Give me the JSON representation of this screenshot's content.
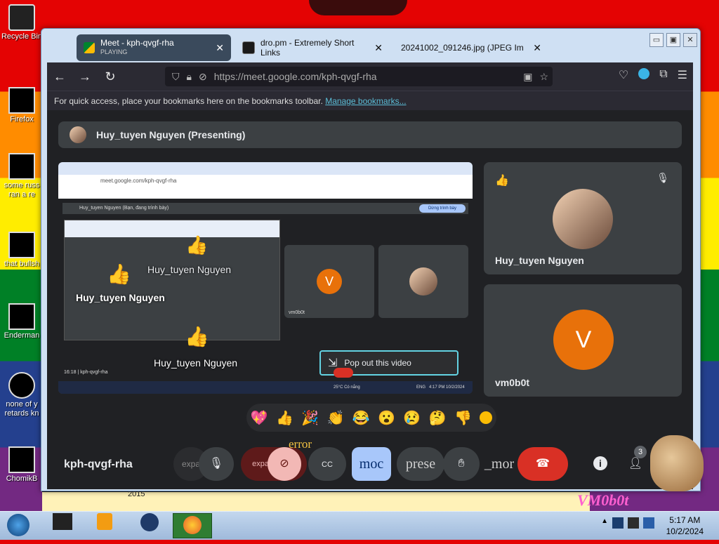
{
  "desktop": {
    "icons": [
      {
        "label": "Recycle Bin",
        "icon": "recycle-bin-icon"
      },
      {
        "label": "Firefox",
        "icon": "firefox-icon"
      },
      {
        "label": "some russ ran a re",
        "icon": "shortcut-icon"
      },
      {
        "label": "that bullsh",
        "icon": "shortcut-icon"
      },
      {
        "label": "Enderman",
        "icon": "shortcut-icon"
      },
      {
        "label": "none of y retards kn",
        "icon": "shortcut-icon"
      },
      {
        "label": "ChomikB",
        "icon": "shortcut-icon"
      }
    ],
    "sticker_text": "VM0b0t",
    "year_text": "2015"
  },
  "browser": {
    "tabs": [
      {
        "title": "Meet - kph-qvgf-rha",
        "subtitle": "PLAYING",
        "icon": "google-meet-icon",
        "close": "✕"
      },
      {
        "title": "dro.pm - Extremely Short Links",
        "icon": "dropm-icon",
        "close": "✕"
      },
      {
        "title": "20241002_091246.jpg (JPEG Image, 4",
        "icon": "image-icon",
        "close": "✕"
      }
    ],
    "window_buttons": [
      "▭",
      "▣",
      "✕"
    ],
    "url": "https://meet.google.com/kph-qvgf-rha",
    "bookmarks_text": "For quick access, place your bookmarks here on the bookmarks toolbar.",
    "bookmarks_link": "Manage bookmarks..."
  },
  "meet": {
    "presenting_label": "Huy_tuyen Nguyen (Presenting)",
    "shared_screen": {
      "inner_url": "meet.google.com/kph-qvgf-rha",
      "inner_banner": "Huy_tuyen Nguyen (Bạn, đang trình bày)",
      "inner_stop": "Dừng trình bày",
      "overlay_name_1": "Huy_tuyen Nguyen",
      "overlay_name_2": "Huy_tuyen Nguyen",
      "overlay_name_3": "Huy_tuyen Nguyen",
      "inner_time": "16:18 | kph-qvgf-rha",
      "inner_tile_label": "vm0b0t",
      "inner_weather": "25°C Có nắng",
      "inner_clock": "4:17 PM 10/2/2024",
      "inner_lang": "ENG"
    },
    "popout_label": "Pop out this video",
    "participants": [
      {
        "name": "Huy_tuyen Nguyen",
        "reaction": "👍",
        "muted": true
      },
      {
        "name": "vm0b0t",
        "initial": "V"
      }
    ],
    "reactions": [
      "💖",
      "👍",
      "🎉",
      "👏",
      "😂",
      "😮",
      "😢",
      "🤔",
      "👎"
    ],
    "meeting_code": "kph-qvgf-rha",
    "controls": {
      "expand_left": "expa",
      "camera_text": "expand_less",
      "error_text": "error",
      "captions_text": "CC",
      "mood_text": "moc",
      "present_text": "prese",
      "more_text": "_mor",
      "participant_count": "3"
    }
  },
  "taskbar": {
    "time": "5:17 AM",
    "date": "10/2/2024"
  }
}
